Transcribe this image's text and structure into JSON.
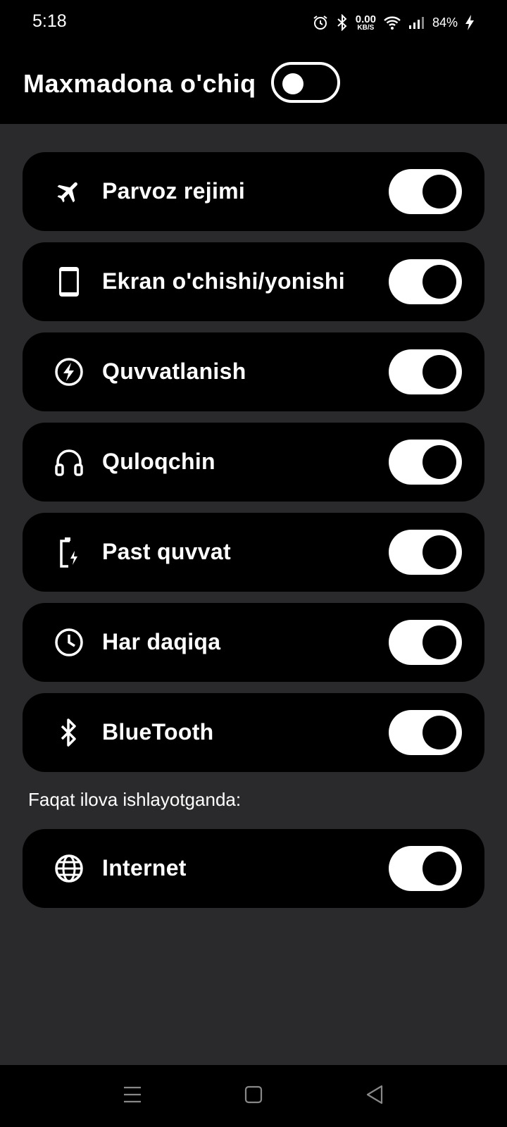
{
  "status_bar": {
    "time": "5:18",
    "icons": [
      "alarm-icon",
      "bluetooth-icon",
      "wifi-icon",
      "signal-icon",
      "charging-icon"
    ],
    "net_speed_value": "0.00",
    "net_speed_unit": "KB/S",
    "battery": "84%"
  },
  "header": {
    "title": "Maxmadona o'chiq",
    "master_enabled": false
  },
  "settings": [
    {
      "label": "Parvoz rejimi",
      "icon": "airplane-icon",
      "enabled": true
    },
    {
      "label": "Ekran o'chishi/yonishi",
      "icon": "phone-screen-icon",
      "enabled": true
    },
    {
      "label": "Quvvatlanish",
      "icon": "charging-bolt-icon",
      "enabled": true
    },
    {
      "label": "Quloqchin",
      "icon": "headphones-icon",
      "enabled": true
    },
    {
      "label": "Past quvvat",
      "icon": "low-battery-icon",
      "enabled": true
    },
    {
      "label": "Har daqiqa",
      "icon": "clock-icon",
      "enabled": true
    },
    {
      "label": "BlueTooth",
      "icon": "bluetooth-icon",
      "enabled": true
    }
  ],
  "app_only_section": {
    "label": "Faqat ilova ishlayotganda:",
    "items": [
      {
        "label": "Internet",
        "icon": "globe-icon",
        "enabled": true
      }
    ]
  },
  "nav_bar": {
    "buttons": [
      "menu-icon",
      "home-icon",
      "back-icon"
    ]
  },
  "colors": {
    "background": "#2a2a2c",
    "card": "#000000",
    "toggle_on": "#ffffff",
    "text": "#ffffff"
  }
}
